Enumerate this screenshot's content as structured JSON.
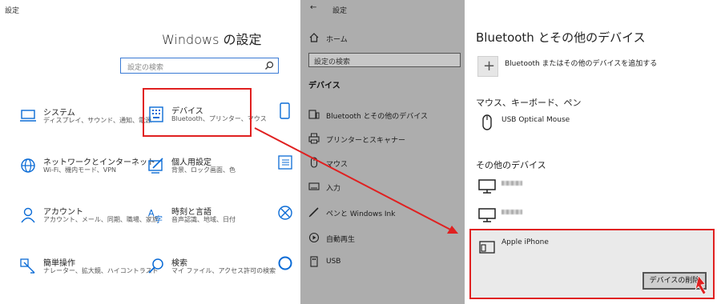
{
  "left": {
    "window_title": "設定",
    "main_title": "Windows の設定",
    "search_placeholder": "設定の検索",
    "tiles": [
      {
        "title": "システム",
        "subtitle": "ディスプレイ、サウンド、通知、電源",
        "icon": "laptop-icon"
      },
      {
        "title": "デバイス",
        "subtitle": "Bluetooth、プリンター、マウス",
        "icon": "keyboard-icon"
      },
      {
        "title": "ネットワークとインターネット",
        "subtitle": "Wi-Fi、機内モード、VPN",
        "icon": "globe-icon"
      },
      {
        "title": "個人用設定",
        "subtitle": "背景、ロック画面、色",
        "icon": "paint-icon"
      },
      {
        "title": "アカウント",
        "subtitle": "アカウント、メール、同期、職場、家族",
        "icon": "person-icon"
      },
      {
        "title": "時刻と言語",
        "subtitle": "音声認識、地域、日付",
        "icon": "language-icon"
      },
      {
        "title": "簡単操作",
        "subtitle": "ナレーター、拡大鏡、ハイコントラスト",
        "icon": "ease-of-access-icon"
      },
      {
        "title": "検索",
        "subtitle": "マイ ファイル、アクセス許可の検索",
        "icon": "search-icon"
      }
    ]
  },
  "middle": {
    "back_glyph": "←",
    "title": "設定",
    "home": "ホーム",
    "search_placeholder": "設定の検索",
    "section": "デバイス",
    "nav": [
      {
        "label": "Bluetooth とその他のデバイス",
        "icon": "bluetooth-devices-icon"
      },
      {
        "label": "プリンターとスキャナー",
        "icon": "printer-icon"
      },
      {
        "label": "マウス",
        "icon": "mouse-icon"
      },
      {
        "label": "入力",
        "icon": "keyboard-input-icon"
      },
      {
        "label": "ペンと Windows Ink",
        "icon": "pen-icon"
      },
      {
        "label": "自動再生",
        "icon": "autoplay-icon"
      },
      {
        "label": "USB",
        "icon": "usb-icon"
      }
    ]
  },
  "right": {
    "title": "Bluetooth とその他のデバイス",
    "add_label": "Bluetooth またはその他のデバイスを追加する",
    "section_mouse": "マウス、キーボード、ペン",
    "usb_mouse": "USB Optical Mouse",
    "section_other": "その他のデバイス",
    "iphone": "Apple iPhone",
    "remove_button": "デバイスの削除"
  },
  "colors": {
    "accent": "#0a6bd6",
    "highlight": "#e02020",
    "mid_panel_bg": "#adadad"
  }
}
